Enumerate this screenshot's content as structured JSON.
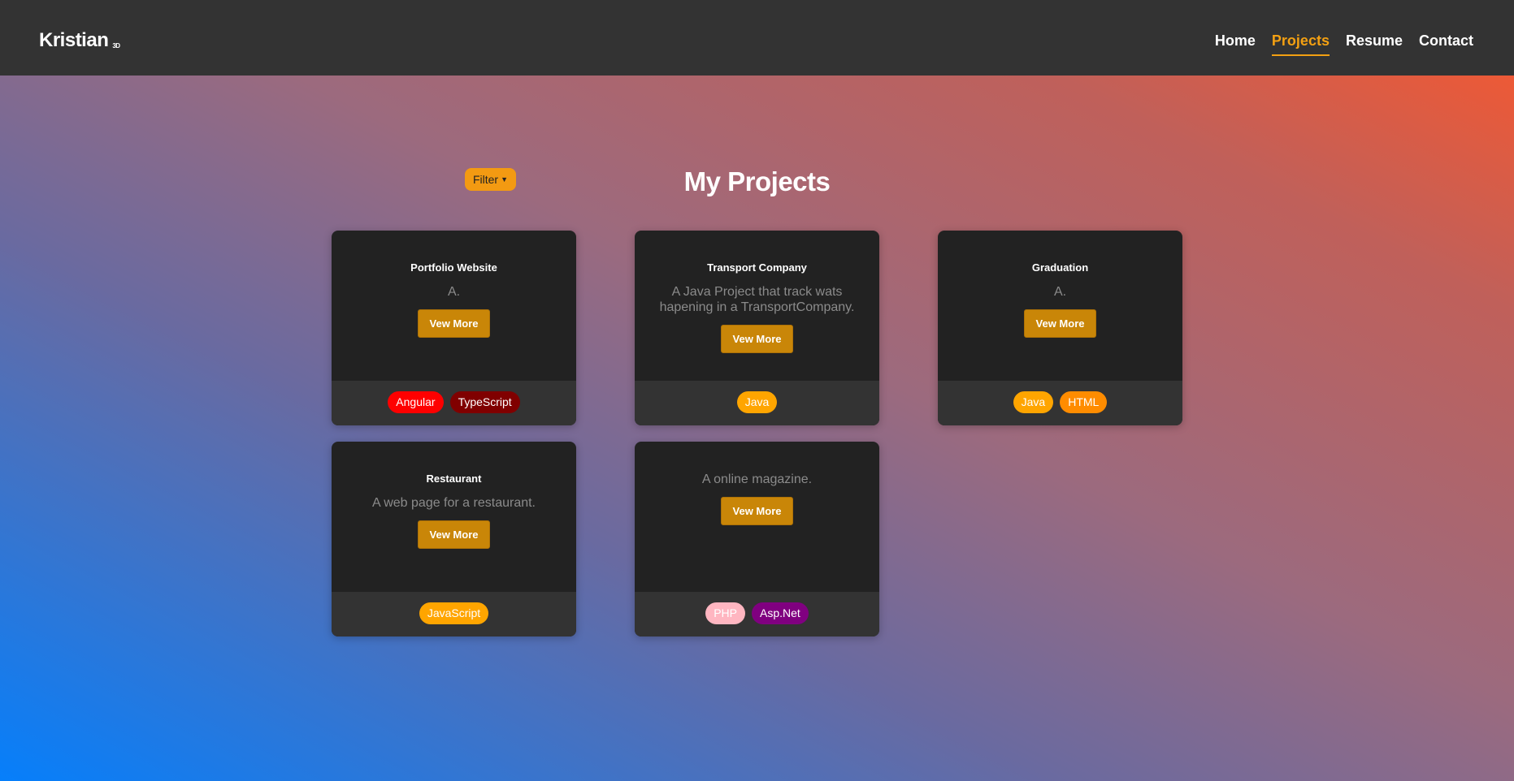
{
  "header": {
    "brand": "Kristian",
    "brand_sup": "3D",
    "nav": [
      {
        "label": "Home"
      },
      {
        "label": "Projects"
      },
      {
        "label": "Resume"
      },
      {
        "label": "Contact"
      }
    ]
  },
  "colors": {
    "accent": "#f3a012",
    "header_bg": "#333333",
    "card_bg": "#222222",
    "button_bg": "#c98608"
  },
  "filter": {
    "label": "Filter",
    "icon": "caret-down-icon"
  },
  "page_title": "My Projects",
  "projects": [
    {
      "title": "Portfolio Website",
      "description": "A.",
      "button": "Vew More",
      "tags": [
        {
          "label": "Angular",
          "color": "#fe0000"
        },
        {
          "label": "TypeScript",
          "color": "#800000"
        }
      ]
    },
    {
      "title": "Transport Company",
      "description": "A Java Project that track wats hapening in a TransportCompany.",
      "button": "Vew More",
      "tags": [
        {
          "label": "Java",
          "color": "#ffa500"
        }
      ]
    },
    {
      "title": "Graduation",
      "description": "A.",
      "button": "Vew More",
      "tags": [
        {
          "label": "Java",
          "color": "#ffa500"
        },
        {
          "label": "HTML",
          "color": "#ff8c00"
        }
      ]
    },
    {
      "title": "Restaurant",
      "description": "A web page for a restaurant.",
      "button": "Vew More",
      "tags": [
        {
          "label": "JavaScript",
          "color": "#ffa500"
        }
      ]
    },
    {
      "title": "",
      "description": "A online magazine.",
      "button": "Vew More",
      "tags": [
        {
          "label": "PHP",
          "color": "#ffb6c1"
        },
        {
          "label": "Asp.Net",
          "color": "#800080"
        }
      ]
    }
  ]
}
